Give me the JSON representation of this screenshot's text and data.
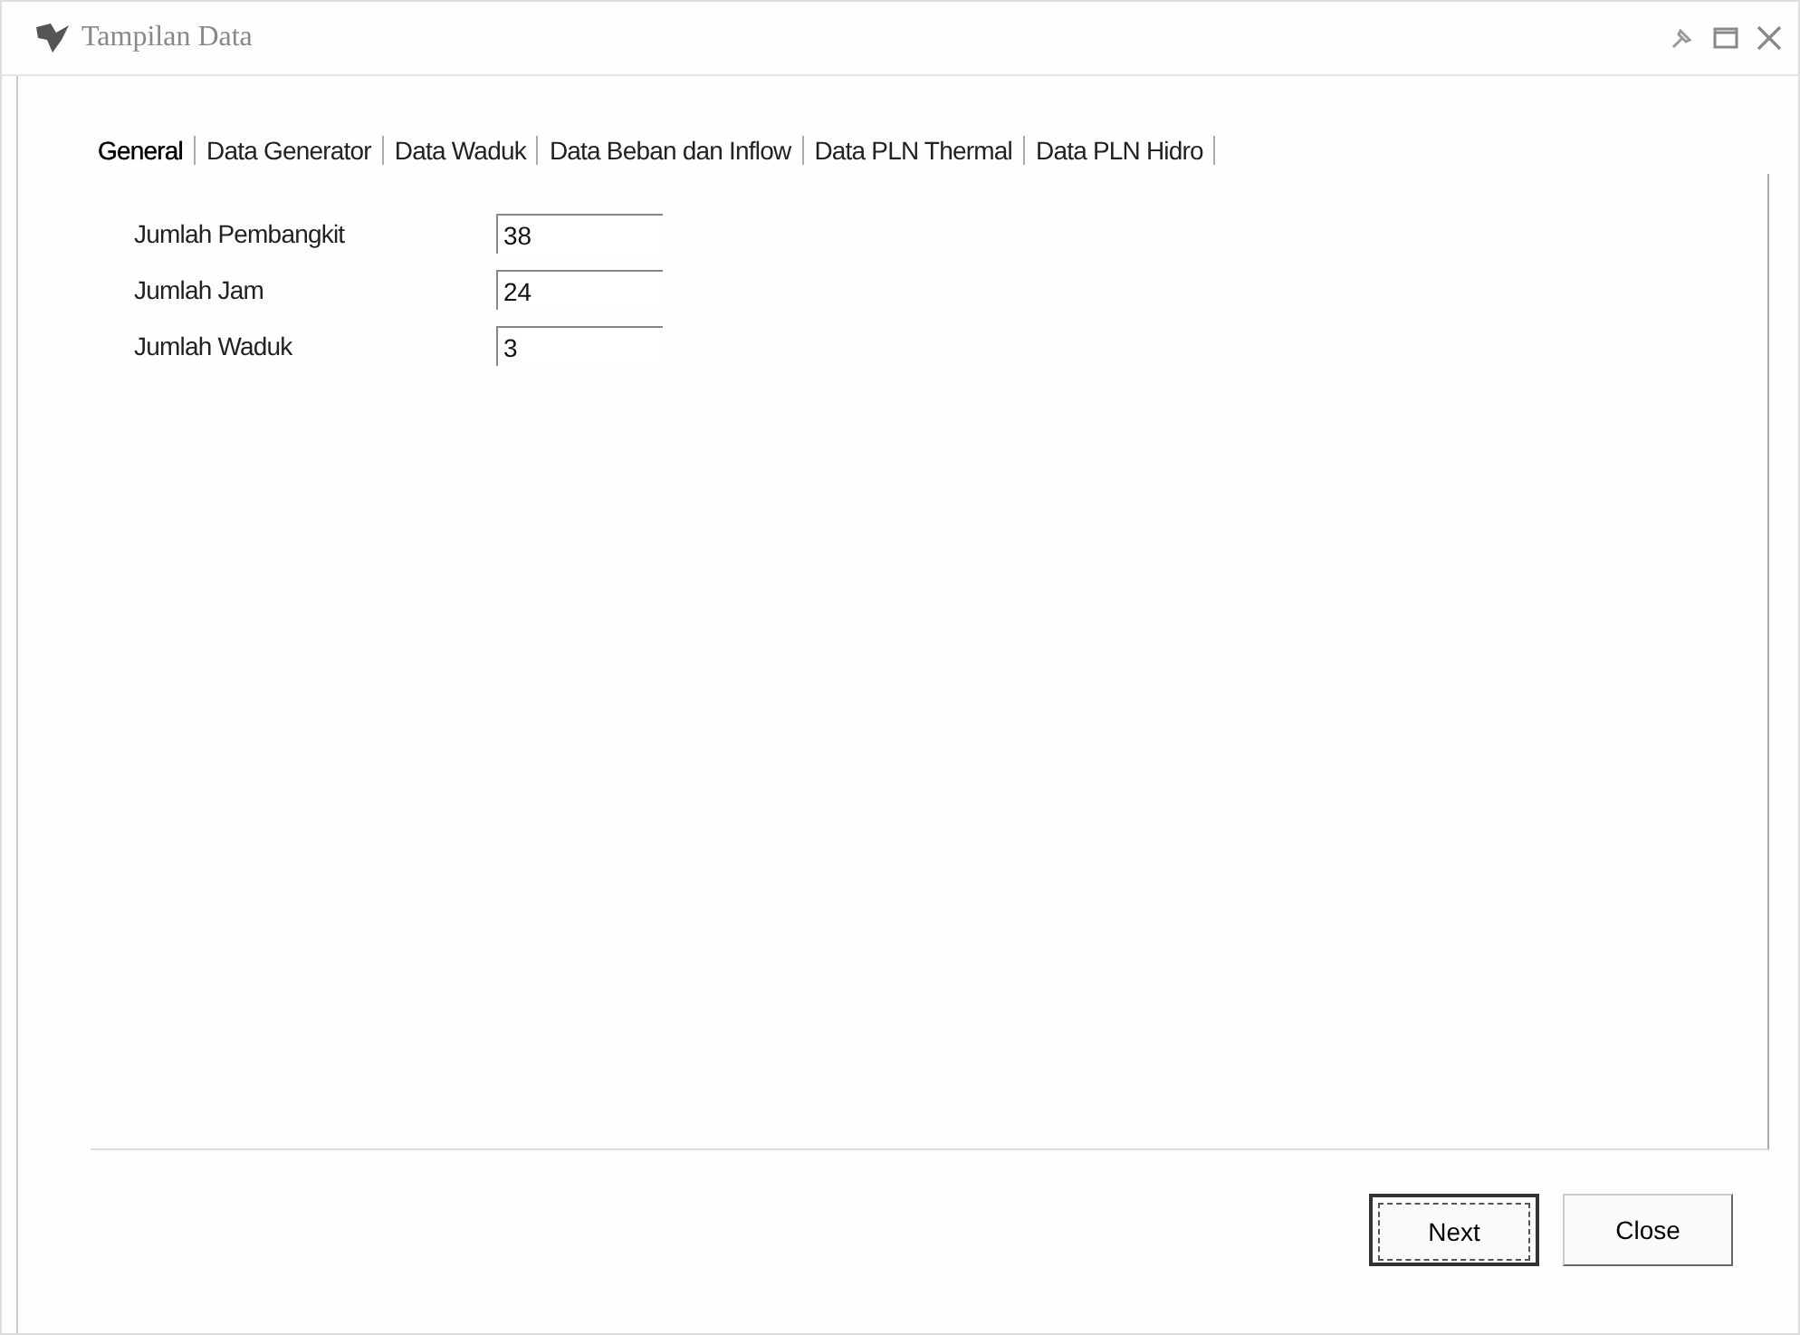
{
  "window": {
    "title": "Tampilan Data"
  },
  "tabs": [
    {
      "label": "General",
      "selected": true
    },
    {
      "label": "Data Generator",
      "selected": false
    },
    {
      "label": "Data Waduk",
      "selected": false
    },
    {
      "label": "Data Beban dan Inflow",
      "selected": false
    },
    {
      "label": "Data PLN Thermal",
      "selected": false
    },
    {
      "label": "Data PLN Hidro",
      "selected": false
    }
  ],
  "fields": [
    {
      "label": "Jumlah Pembangkit",
      "value": "38"
    },
    {
      "label": "Jumlah Jam",
      "value": "24"
    },
    {
      "label": "Jumlah Waduk",
      "value": "3"
    }
  ],
  "buttons": [
    {
      "label": "Next",
      "default": true
    },
    {
      "label": "Close",
      "default": false
    }
  ]
}
